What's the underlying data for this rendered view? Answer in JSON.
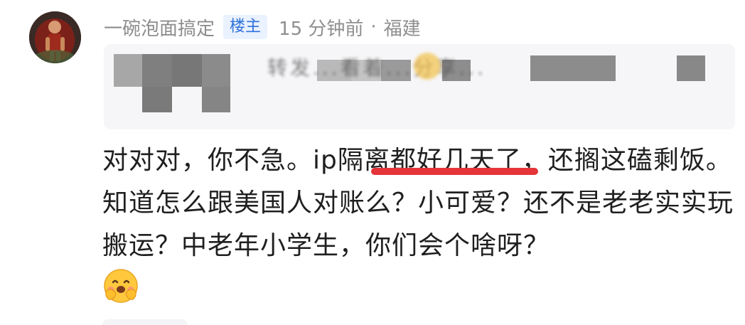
{
  "comment": {
    "username": "一碗泡面搞定",
    "badge": "楼主",
    "time": "15 分钟前",
    "separator": "·",
    "location": "福建",
    "quote_text": "转发...看着...分享...",
    "text_before": "对对对，你不急。ip",
    "text_underlined": "隔离都好几天了",
    "text_after": "，还搁这磕剩饭。知道怎么跟美国人对账么？小可爱？还不是老老实实玩搬运？中老年小学生，你们会个啥呀？",
    "reaction_emoji": "hugging-face-icon"
  }
}
